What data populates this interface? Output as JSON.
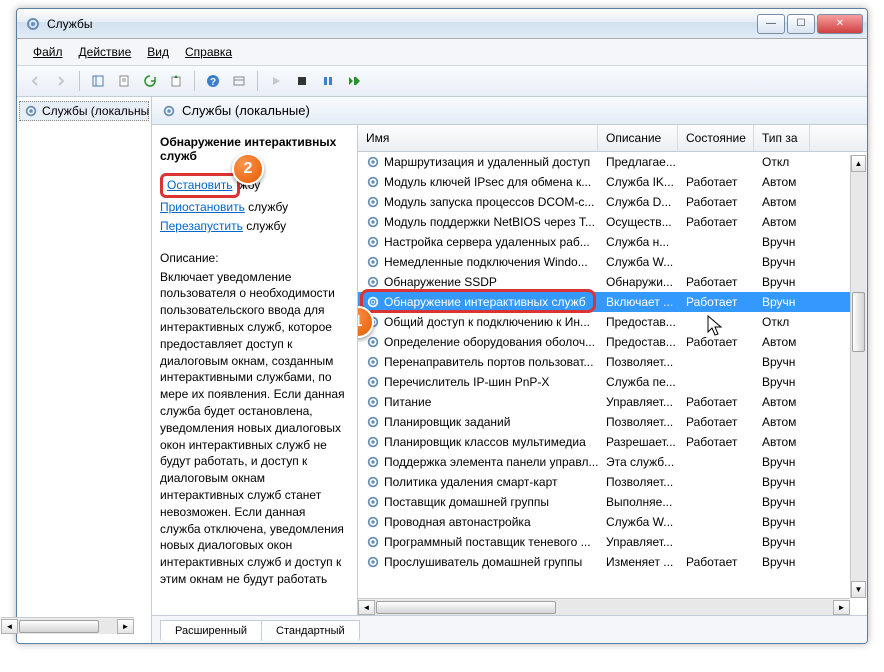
{
  "window": {
    "title": "Службы"
  },
  "menu": {
    "file": "Файл",
    "action": "Действие",
    "view": "Вид",
    "help": "Справка"
  },
  "tree": {
    "root": "Службы (локальны"
  },
  "header": {
    "title": "Службы (локальные)"
  },
  "detail": {
    "service_name": "Обнаружение интерактивных служб",
    "stop_link": "Остановить",
    "stop_suffix": "жбу",
    "pause_link": "Приостановить",
    "pause_suffix": " службу",
    "restart_link": "Перезапустить",
    "restart_suffix": " службу",
    "desc_label": "Описание:",
    "description": "Включает уведомление пользователя о необходимости пользовательского ввода для интерактивных служб, которое предоставляет доступ к диалоговым окнам, созданным интерактивными службами, по мере их появления. Если данная служба будет остановлена, уведомления новых диалоговых окон интерактивных служб не будут работать, и доступ к диалоговым окнам интерактивных служб станет невозможен. Если данная служба отключена, уведомления новых диалоговых окон интерактивных служб и доступ к этим окнам не будут работать"
  },
  "columns": {
    "name": "Имя",
    "desc": "Описание",
    "state": "Состояние",
    "start": "Тип за"
  },
  "services": [
    {
      "name": "Маршрутизация и удаленный доступ",
      "desc": "Предлагае...",
      "state": "",
      "start": "Откл"
    },
    {
      "name": "Модуль ключей IPsec для обмена к...",
      "desc": "Служба IK...",
      "state": "Работает",
      "start": "Автом"
    },
    {
      "name": "Модуль запуска процессов DCOM-с...",
      "desc": "Служба D...",
      "state": "Работает",
      "start": "Автом"
    },
    {
      "name": "Модуль поддержки NetBIOS через T...",
      "desc": "Осуществ...",
      "state": "Работает",
      "start": "Автом"
    },
    {
      "name": "Настройка сервера удаленных раб...",
      "desc": "Служба н...",
      "state": "",
      "start": "Вручн"
    },
    {
      "name": "Немедленные подключения Windo...",
      "desc": "Служба W...",
      "state": "",
      "start": "Вручн"
    },
    {
      "name": "Обнаружение SSDP",
      "desc": "Обнаружи...",
      "state": "Работает",
      "start": "Вручн"
    },
    {
      "name": "Обнаружение интерактивных служб",
      "desc": "Включает ...",
      "state": "Работает",
      "start": "Вручн",
      "selected": true
    },
    {
      "name": "Общий доступ к подключению к Ин...",
      "desc": "Предостав...",
      "state": "",
      "start": "Откл"
    },
    {
      "name": "Определение оборудования оболоч...",
      "desc": "Предостав...",
      "state": "Работает",
      "start": "Автом"
    },
    {
      "name": "Перенаправитель портов пользоват...",
      "desc": "Позволяет...",
      "state": "",
      "start": "Вручн"
    },
    {
      "name": "Перечислитель IP-шин PnP-X",
      "desc": "Служба пе...",
      "state": "",
      "start": "Вручн"
    },
    {
      "name": "Питание",
      "desc": "Управляет...",
      "state": "Работает",
      "start": "Автом"
    },
    {
      "name": "Планировщик заданий",
      "desc": "Позволяет...",
      "state": "Работает",
      "start": "Автом"
    },
    {
      "name": "Планировщик классов мультимедиа",
      "desc": "Разрешает...",
      "state": "Работает",
      "start": "Автом"
    },
    {
      "name": "Поддержка элемента панели управл...",
      "desc": "Эта служб...",
      "state": "",
      "start": "Вручн"
    },
    {
      "name": "Политика удаления смарт-карт",
      "desc": "Позволяет...",
      "state": "",
      "start": "Вручн"
    },
    {
      "name": "Поставщик домашней группы",
      "desc": "Выполняе...",
      "state": "",
      "start": "Вручн"
    },
    {
      "name": "Проводная автонастройка",
      "desc": "Служба W...",
      "state": "",
      "start": "Вручн"
    },
    {
      "name": "Программный поставщик теневого ...",
      "desc": "Управляет...",
      "state": "",
      "start": "Вручн"
    },
    {
      "name": "Прослушиватель домашней группы",
      "desc": "Изменяет ...",
      "state": "Работает",
      "start": "Вручн"
    }
  ],
  "tabs": {
    "extended": "Расширенный",
    "standard": "Стандартный"
  },
  "callouts": {
    "one": "1",
    "two": "2"
  }
}
